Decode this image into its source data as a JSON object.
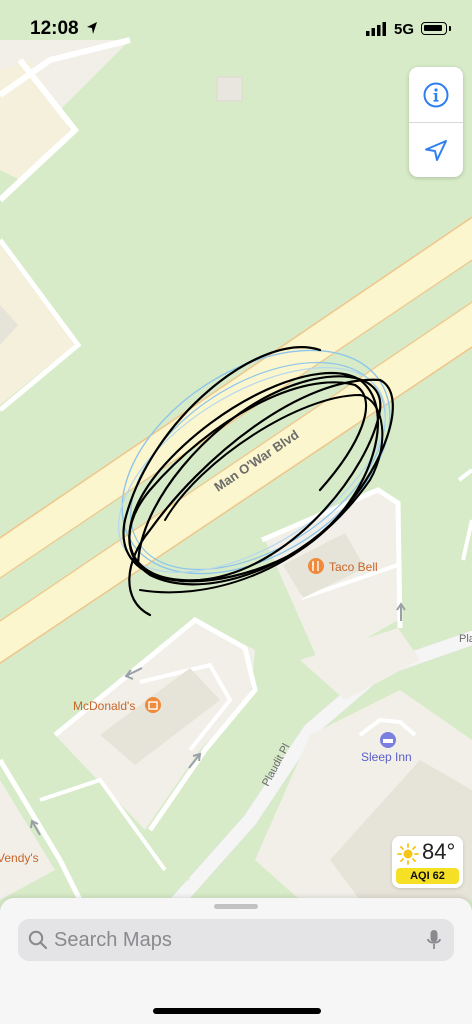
{
  "status_bar": {
    "time": "12:08",
    "network": "5G"
  },
  "map": {
    "road_labels": {
      "main_road": "Man O'War Blvd",
      "side_road": "Plaudit Pl",
      "side_road_cut": "Pla"
    },
    "places": {
      "taco_bell": "Taco Bell",
      "mcdonalds": "McDonald's",
      "sleep_inn": "Sleep Inn",
      "wendys_cut": "Vendy's"
    },
    "colors": {
      "park_green": "#d7ebc8",
      "road_fill": "#fbf6cd",
      "road_edge": "#f0c58a",
      "lot_fill": "#f1efe8",
      "restaurant_orange": "#f08a3c",
      "hotel_purple": "#7b7fe0",
      "label_restaurant": "#c8662a",
      "label_hotel": "#5a5fc8",
      "accent_blue": "#2f7ff0",
      "scribble_blue": "#8ec5ea"
    }
  },
  "controls": {
    "info_icon": "info-icon",
    "location_icon": "location-arrow-icon"
  },
  "weather": {
    "temperature": "84°",
    "aqi": "AQI 62",
    "icon": "sun-icon"
  },
  "search": {
    "placeholder": "Search Maps"
  }
}
